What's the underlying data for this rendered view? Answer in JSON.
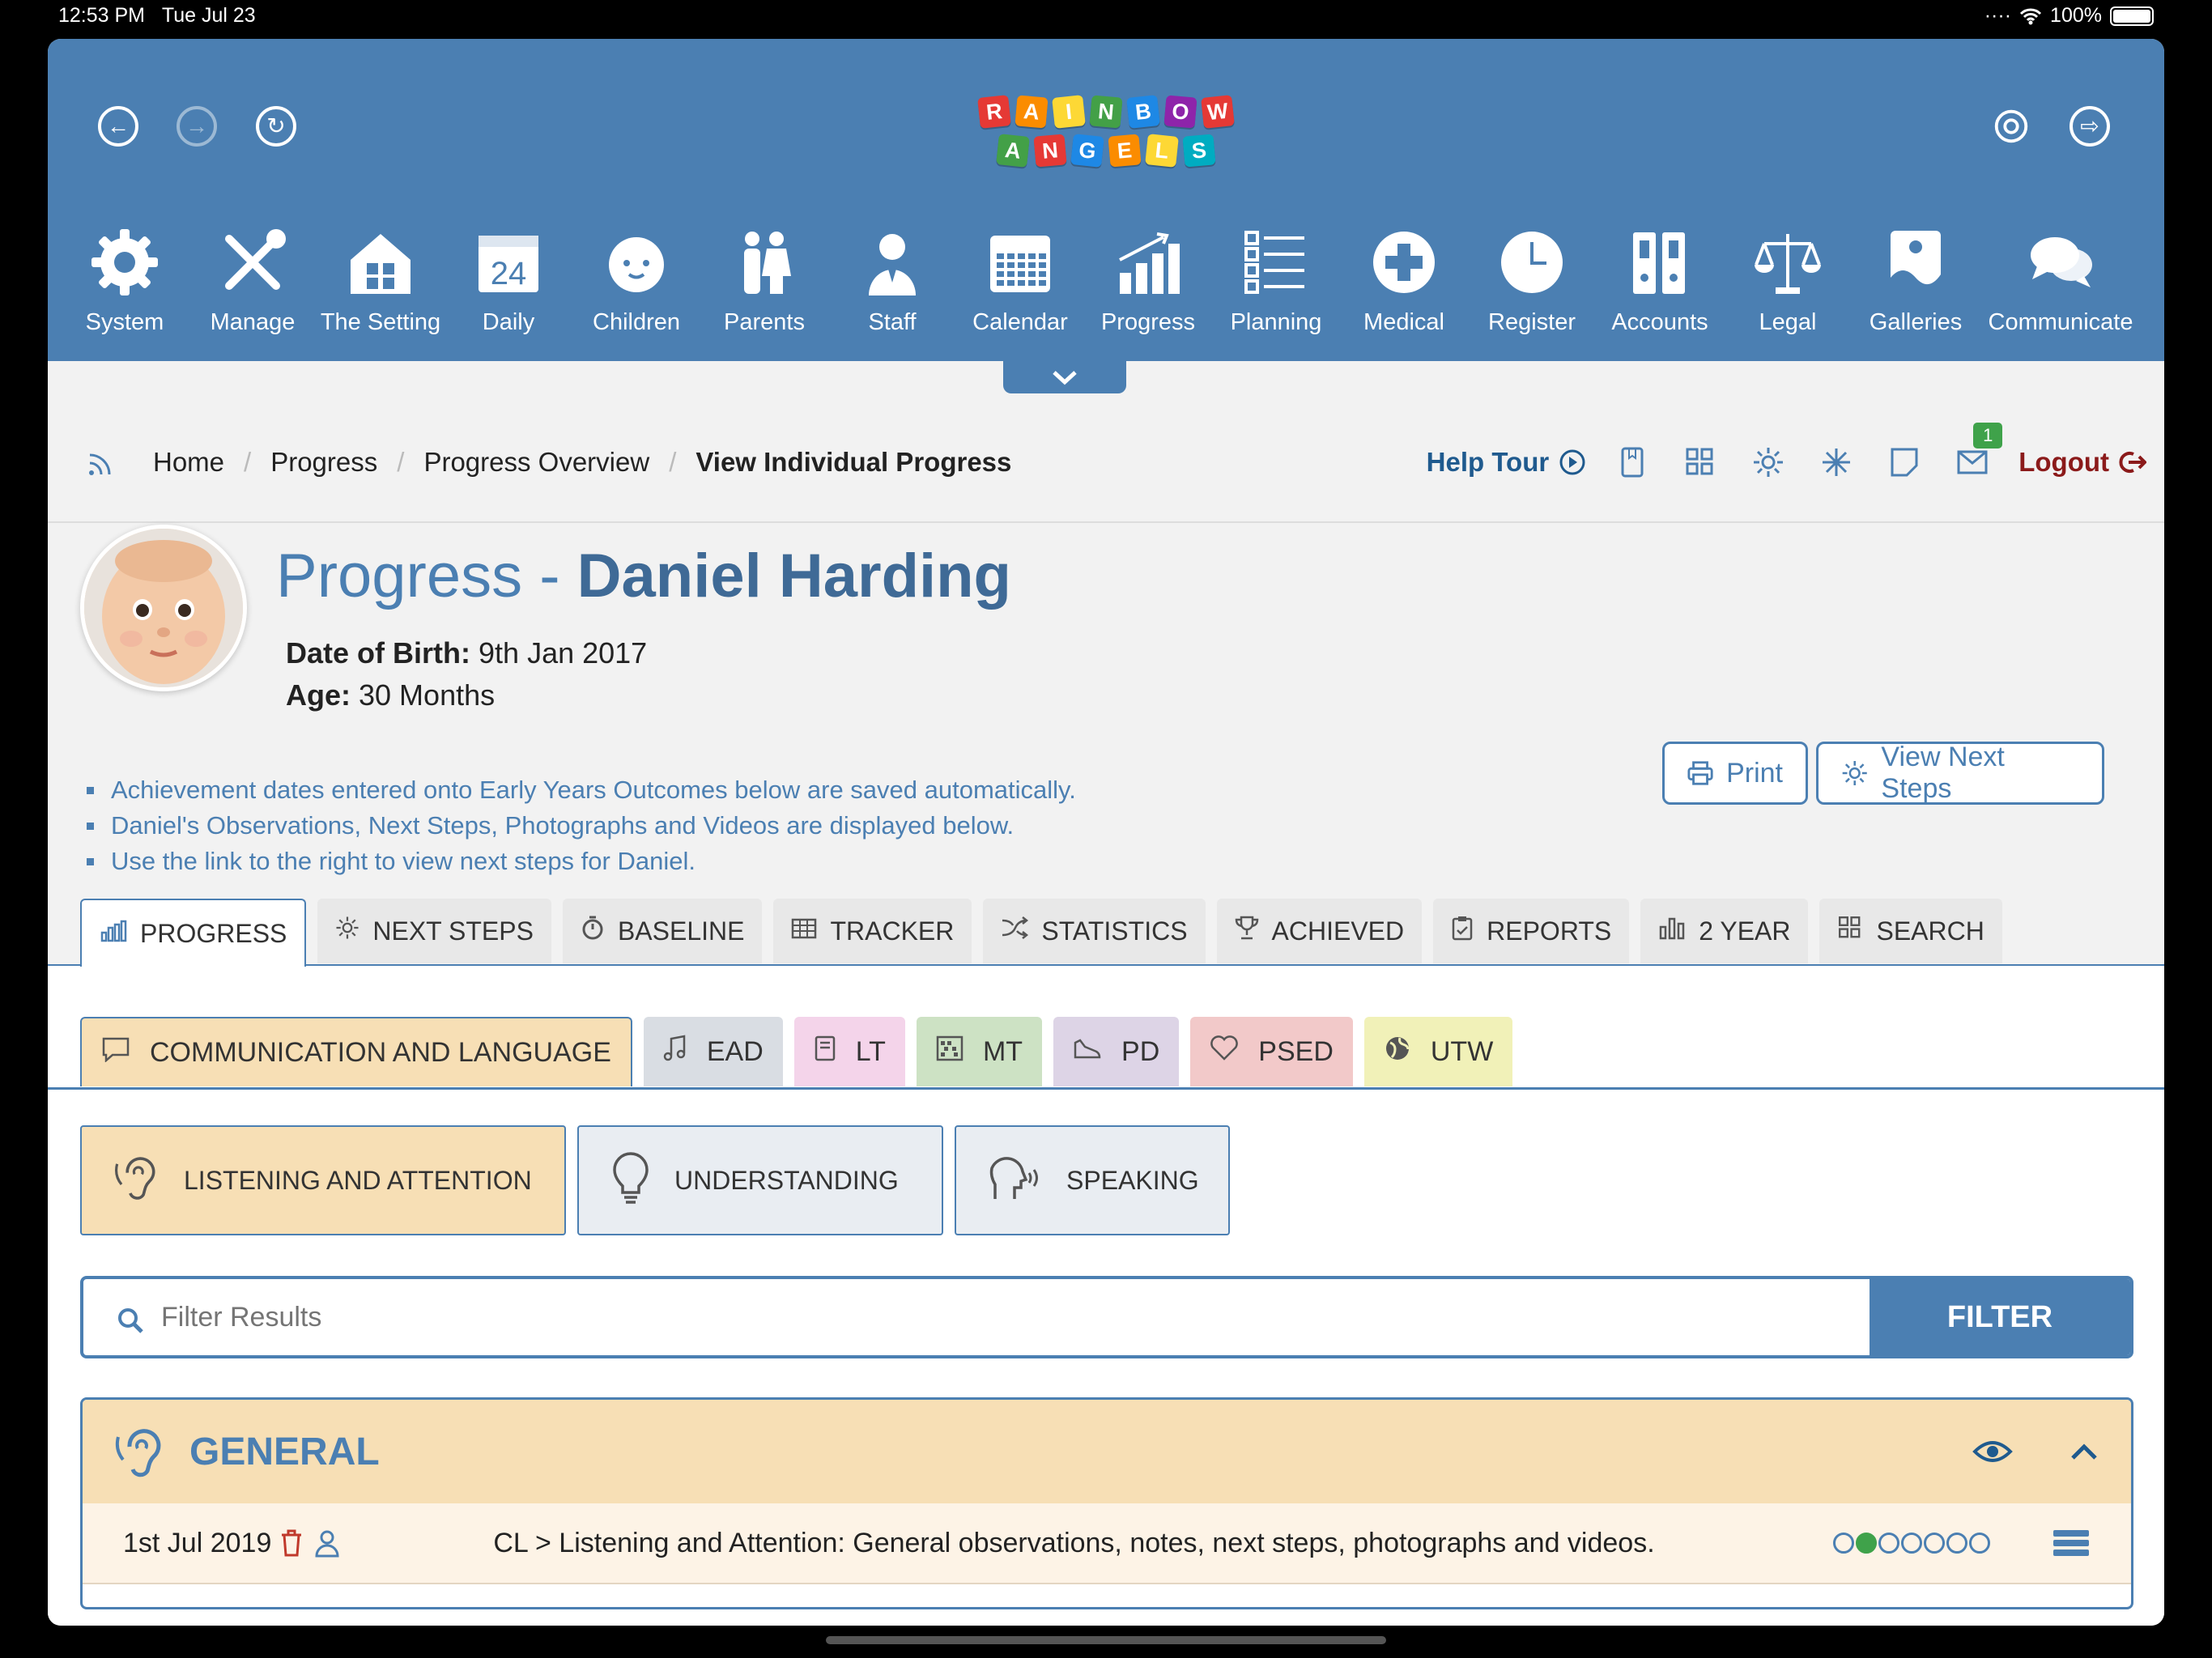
{
  "status_bar": {
    "time": "12:53 PM",
    "date": "Tue Jul 23",
    "battery": "100%"
  },
  "logo": {
    "letters_top": [
      "R",
      "A",
      "I",
      "N",
      "B",
      "O",
      "W"
    ],
    "letters_bottom": [
      "A",
      "N",
      "G",
      "E",
      "L",
      "S"
    ]
  },
  "nav": [
    {
      "label": "System",
      "icon": "gear-icon"
    },
    {
      "label": "Manage",
      "icon": "tools-icon"
    },
    {
      "label": "The Setting",
      "icon": "house-icon"
    },
    {
      "label": "Daily",
      "icon": "calendar-day-icon",
      "day": "24"
    },
    {
      "label": "Children",
      "icon": "baby-face-icon"
    },
    {
      "label": "Parents",
      "icon": "parents-icon"
    },
    {
      "label": "Staff",
      "icon": "staff-icon"
    },
    {
      "label": "Calendar",
      "icon": "calendar-grid-icon"
    },
    {
      "label": "Progress",
      "icon": "bar-chart-icon"
    },
    {
      "label": "Planning",
      "icon": "checklist-icon"
    },
    {
      "label": "Medical",
      "icon": "medical-cross-icon"
    },
    {
      "label": "Register",
      "icon": "clock-icon"
    },
    {
      "label": "Accounts",
      "icon": "binders-icon"
    },
    {
      "label": "Legal",
      "icon": "scales-icon"
    },
    {
      "label": "Galleries",
      "icon": "gallery-icon"
    },
    {
      "label": "Communicate",
      "icon": "speech-bubbles-icon"
    }
  ],
  "breadcrumb": [
    "Home",
    "Progress",
    "Progress Overview",
    "View Individual Progress"
  ],
  "toolbar": {
    "help_tour": "Help Tour",
    "logout": "Logout",
    "mail_count": "1"
  },
  "child": {
    "title_prefix": "Progress - ",
    "name": "Daniel Harding",
    "dob_label": "Date of Birth:",
    "dob": "9th Jan 2017",
    "age_label": "Age:",
    "age": "30 Months"
  },
  "notes": [
    "Achievement dates entered onto Early Years Outcomes below are saved automatically.",
    "Daniel's Observations, Next Steps, Photographs and Videos are displayed below.",
    "Use the link to the right to view next steps for Daniel."
  ],
  "buttons": {
    "print": "Print",
    "view_next_steps": "View Next Steps"
  },
  "tabs": [
    {
      "label": "PROGRESS",
      "icon": "chart-icon",
      "active": true
    },
    {
      "label": "NEXT STEPS",
      "icon": "sun-icon"
    },
    {
      "label": "BASELINE",
      "icon": "stopwatch-icon"
    },
    {
      "label": "TRACKER",
      "icon": "table-icon"
    },
    {
      "label": "STATISTICS",
      "icon": "shuffle-icon"
    },
    {
      "label": "ACHIEVED",
      "icon": "trophy-icon"
    },
    {
      "label": "REPORTS",
      "icon": "clipboard-icon"
    },
    {
      "label": "2 YEAR",
      "icon": "bars-icon"
    },
    {
      "label": "SEARCH",
      "icon": "grid-search-icon"
    }
  ],
  "areas": [
    {
      "label": "COMMUNICATION AND LANGUAGE",
      "icon": "speech-bubble-icon",
      "color": "#f7dfb5",
      "active": true
    },
    {
      "label": "EAD",
      "icon": "music-note-icon",
      "color": "#d9dde3"
    },
    {
      "label": "LT",
      "icon": "book-icon",
      "color": "#f4d4ea"
    },
    {
      "label": "MT",
      "icon": "abacus-icon",
      "color": "#cde2c4"
    },
    {
      "label": "PD",
      "icon": "shoe-icon",
      "color": "#ddd4e6"
    },
    {
      "label": "PSED",
      "icon": "heart-icon",
      "color": "#f2c9c9"
    },
    {
      "label": "UTW",
      "icon": "globe-icon",
      "color": "#f1f1b8"
    }
  ],
  "subareas": [
    {
      "label": "LISTENING AND ATTENTION",
      "icon": "ear-icon",
      "active": true
    },
    {
      "label": "UNDERSTANDING",
      "icon": "lightbulb-icon"
    },
    {
      "label": "SPEAKING",
      "icon": "speaking-head-icon"
    }
  ],
  "filter": {
    "placeholder": "Filter Results",
    "button": "FILTER"
  },
  "section": {
    "title": "GENERAL"
  },
  "entry": {
    "date": "1st Jul 2019",
    "text": "CL > Listening and Attention: General observations, notes, next steps, photographs and videos.",
    "progress_filled_index": 1,
    "progress_total": 7
  },
  "colors": {
    "brand": "#4b7fb2",
    "accent_green": "#3fa24a",
    "logout_red": "#8b1a1a",
    "delete_red": "#c0392b"
  }
}
